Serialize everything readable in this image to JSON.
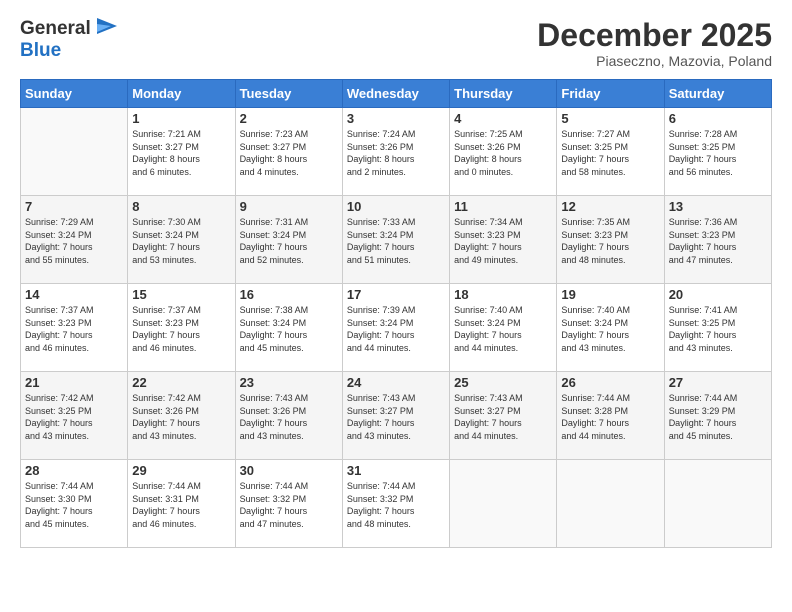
{
  "header": {
    "logo_general": "General",
    "logo_blue": "Blue",
    "title": "December 2025",
    "subtitle": "Piaseczno, Mazovia, Poland"
  },
  "days_of_week": [
    "Sunday",
    "Monday",
    "Tuesday",
    "Wednesday",
    "Thursday",
    "Friday",
    "Saturday"
  ],
  "weeks": [
    [
      {
        "day": "",
        "info": ""
      },
      {
        "day": "1",
        "info": "Sunrise: 7:21 AM\nSunset: 3:27 PM\nDaylight: 8 hours\nand 6 minutes."
      },
      {
        "day": "2",
        "info": "Sunrise: 7:23 AM\nSunset: 3:27 PM\nDaylight: 8 hours\nand 4 minutes."
      },
      {
        "day": "3",
        "info": "Sunrise: 7:24 AM\nSunset: 3:26 PM\nDaylight: 8 hours\nand 2 minutes."
      },
      {
        "day": "4",
        "info": "Sunrise: 7:25 AM\nSunset: 3:26 PM\nDaylight: 8 hours\nand 0 minutes."
      },
      {
        "day": "5",
        "info": "Sunrise: 7:27 AM\nSunset: 3:25 PM\nDaylight: 7 hours\nand 58 minutes."
      },
      {
        "day": "6",
        "info": "Sunrise: 7:28 AM\nSunset: 3:25 PM\nDaylight: 7 hours\nand 56 minutes."
      }
    ],
    [
      {
        "day": "7",
        "info": "Sunrise: 7:29 AM\nSunset: 3:24 PM\nDaylight: 7 hours\nand 55 minutes."
      },
      {
        "day": "8",
        "info": "Sunrise: 7:30 AM\nSunset: 3:24 PM\nDaylight: 7 hours\nand 53 minutes."
      },
      {
        "day": "9",
        "info": "Sunrise: 7:31 AM\nSunset: 3:24 PM\nDaylight: 7 hours\nand 52 minutes."
      },
      {
        "day": "10",
        "info": "Sunrise: 7:33 AM\nSunset: 3:24 PM\nDaylight: 7 hours\nand 51 minutes."
      },
      {
        "day": "11",
        "info": "Sunrise: 7:34 AM\nSunset: 3:23 PM\nDaylight: 7 hours\nand 49 minutes."
      },
      {
        "day": "12",
        "info": "Sunrise: 7:35 AM\nSunset: 3:23 PM\nDaylight: 7 hours\nand 48 minutes."
      },
      {
        "day": "13",
        "info": "Sunrise: 7:36 AM\nSunset: 3:23 PM\nDaylight: 7 hours\nand 47 minutes."
      }
    ],
    [
      {
        "day": "14",
        "info": "Sunrise: 7:37 AM\nSunset: 3:23 PM\nDaylight: 7 hours\nand 46 minutes."
      },
      {
        "day": "15",
        "info": "Sunrise: 7:37 AM\nSunset: 3:23 PM\nDaylight: 7 hours\nand 46 minutes."
      },
      {
        "day": "16",
        "info": "Sunrise: 7:38 AM\nSunset: 3:24 PM\nDaylight: 7 hours\nand 45 minutes."
      },
      {
        "day": "17",
        "info": "Sunrise: 7:39 AM\nSunset: 3:24 PM\nDaylight: 7 hours\nand 44 minutes."
      },
      {
        "day": "18",
        "info": "Sunrise: 7:40 AM\nSunset: 3:24 PM\nDaylight: 7 hours\nand 44 minutes."
      },
      {
        "day": "19",
        "info": "Sunrise: 7:40 AM\nSunset: 3:24 PM\nDaylight: 7 hours\nand 43 minutes."
      },
      {
        "day": "20",
        "info": "Sunrise: 7:41 AM\nSunset: 3:25 PM\nDaylight: 7 hours\nand 43 minutes."
      }
    ],
    [
      {
        "day": "21",
        "info": "Sunrise: 7:42 AM\nSunset: 3:25 PM\nDaylight: 7 hours\nand 43 minutes."
      },
      {
        "day": "22",
        "info": "Sunrise: 7:42 AM\nSunset: 3:26 PM\nDaylight: 7 hours\nand 43 minutes."
      },
      {
        "day": "23",
        "info": "Sunrise: 7:43 AM\nSunset: 3:26 PM\nDaylight: 7 hours\nand 43 minutes."
      },
      {
        "day": "24",
        "info": "Sunrise: 7:43 AM\nSunset: 3:27 PM\nDaylight: 7 hours\nand 43 minutes."
      },
      {
        "day": "25",
        "info": "Sunrise: 7:43 AM\nSunset: 3:27 PM\nDaylight: 7 hours\nand 44 minutes."
      },
      {
        "day": "26",
        "info": "Sunrise: 7:44 AM\nSunset: 3:28 PM\nDaylight: 7 hours\nand 44 minutes."
      },
      {
        "day": "27",
        "info": "Sunrise: 7:44 AM\nSunset: 3:29 PM\nDaylight: 7 hours\nand 45 minutes."
      }
    ],
    [
      {
        "day": "28",
        "info": "Sunrise: 7:44 AM\nSunset: 3:30 PM\nDaylight: 7 hours\nand 45 minutes."
      },
      {
        "day": "29",
        "info": "Sunrise: 7:44 AM\nSunset: 3:31 PM\nDaylight: 7 hours\nand 46 minutes."
      },
      {
        "day": "30",
        "info": "Sunrise: 7:44 AM\nSunset: 3:32 PM\nDaylight: 7 hours\nand 47 minutes."
      },
      {
        "day": "31",
        "info": "Sunrise: 7:44 AM\nSunset: 3:32 PM\nDaylight: 7 hours\nand 48 minutes."
      },
      {
        "day": "",
        "info": ""
      },
      {
        "day": "",
        "info": ""
      },
      {
        "day": "",
        "info": ""
      }
    ]
  ]
}
